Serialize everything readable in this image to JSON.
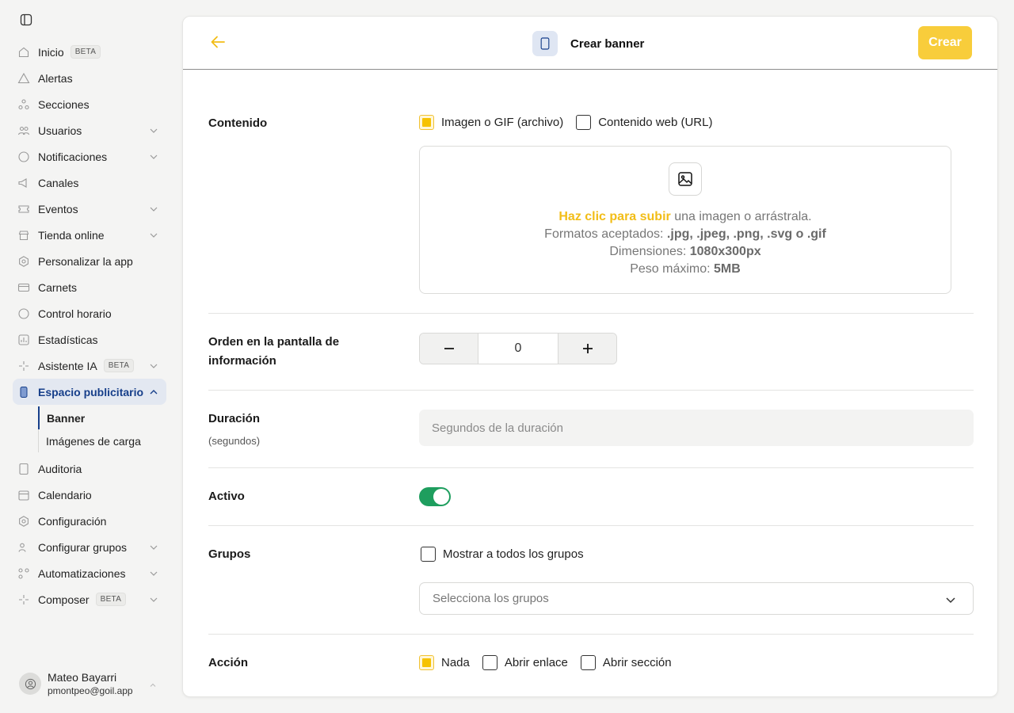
{
  "sidebar": {
    "items": [
      {
        "id": "inicio",
        "label": "Inicio",
        "badge": "BETA",
        "icon": "home-icon"
      },
      {
        "id": "alertas",
        "label": "Alertas",
        "icon": "alert-icon"
      },
      {
        "id": "secciones",
        "label": "Secciones",
        "icon": "sections-icon"
      },
      {
        "id": "usuarios",
        "label": "Usuarios",
        "icon": "users-icon",
        "expandable": true
      },
      {
        "id": "notificaciones",
        "label": "Notificaciones",
        "icon": "chat-icon",
        "expandable": true
      },
      {
        "id": "canales",
        "label": "Canales",
        "icon": "megaphone-icon"
      },
      {
        "id": "eventos",
        "label": "Eventos",
        "icon": "ticket-icon",
        "expandable": true
      },
      {
        "id": "tienda",
        "label": "Tienda online",
        "icon": "store-icon",
        "expandable": true
      },
      {
        "id": "personalizar",
        "label": "Personalizar la app",
        "icon": "palette-icon"
      },
      {
        "id": "carnets",
        "label": "Carnets",
        "icon": "card-icon"
      },
      {
        "id": "control",
        "label": "Control horario",
        "icon": "clock-icon"
      },
      {
        "id": "estadisticas",
        "label": "Estadísticas",
        "icon": "stats-icon"
      },
      {
        "id": "asistente",
        "label": "Asistente IA",
        "badge": "BETA",
        "icon": "sparkle-icon",
        "expandable": true
      },
      {
        "id": "espacio",
        "label": "Espacio publicitario",
        "icon": "phone-icon",
        "expanded": true,
        "active": true
      }
    ],
    "sub_items": [
      {
        "label": "Banner",
        "current": true
      },
      {
        "label": "Imágenes de carga"
      }
    ],
    "items_after": [
      {
        "id": "auditoria",
        "label": "Auditoria",
        "icon": "document-icon"
      },
      {
        "id": "calendario",
        "label": "Calendario",
        "icon": "calendar-icon"
      },
      {
        "id": "configuracion",
        "label": "Configuración",
        "icon": "gear-icon"
      },
      {
        "id": "grupos",
        "label": "Configurar grupos",
        "icon": "group-icon",
        "expandable": true
      },
      {
        "id": "automatizaciones",
        "label": "Automatizaciones",
        "icon": "automation-icon",
        "expandable": true
      },
      {
        "id": "composer",
        "label": "Composer",
        "badge": "BETA",
        "icon": "sparkle-icon",
        "expandable": true
      }
    ],
    "user": {
      "name": "Mateo Bayarri",
      "email": "pmontpeo@goil.app"
    }
  },
  "header": {
    "title": "Crear banner",
    "create_label": "Crear"
  },
  "form": {
    "contenido": {
      "label": "Contenido",
      "option_image": "Imagen o GIF (archivo)",
      "option_web": "Contenido web (URL)",
      "upload_link": "Haz clic para subir",
      "upload_text": " una imagen o arrástrala.",
      "formats_label": "Formatos aceptados: ",
      "formats_value": ".jpg, .jpeg, .png, .svg o .gif",
      "dims_label": "Dimensiones: ",
      "dims_value": "1080x300px",
      "weight_label": "Peso máximo: ",
      "weight_value": "5MB"
    },
    "orden": {
      "label": "Orden en la pantalla de información",
      "value": "0"
    },
    "duracion": {
      "label": "Duración",
      "sub_label": "(segundos)",
      "placeholder": "Segundos de la duración"
    },
    "activo": {
      "label": "Activo",
      "on": true
    },
    "grupos": {
      "label": "Grupos",
      "all_groups": "Mostrar a todos los grupos",
      "select_placeholder": "Selecciona los grupos"
    },
    "accion": {
      "label": "Acción",
      "option_nada": "Nada",
      "option_enlace": "Abrir enlace",
      "option_seccion": "Abrir sección"
    }
  },
  "colors": {
    "accent": "#f8cd3b",
    "active_nav": "#173f8a",
    "toggle_on": "#1e9e5e"
  }
}
